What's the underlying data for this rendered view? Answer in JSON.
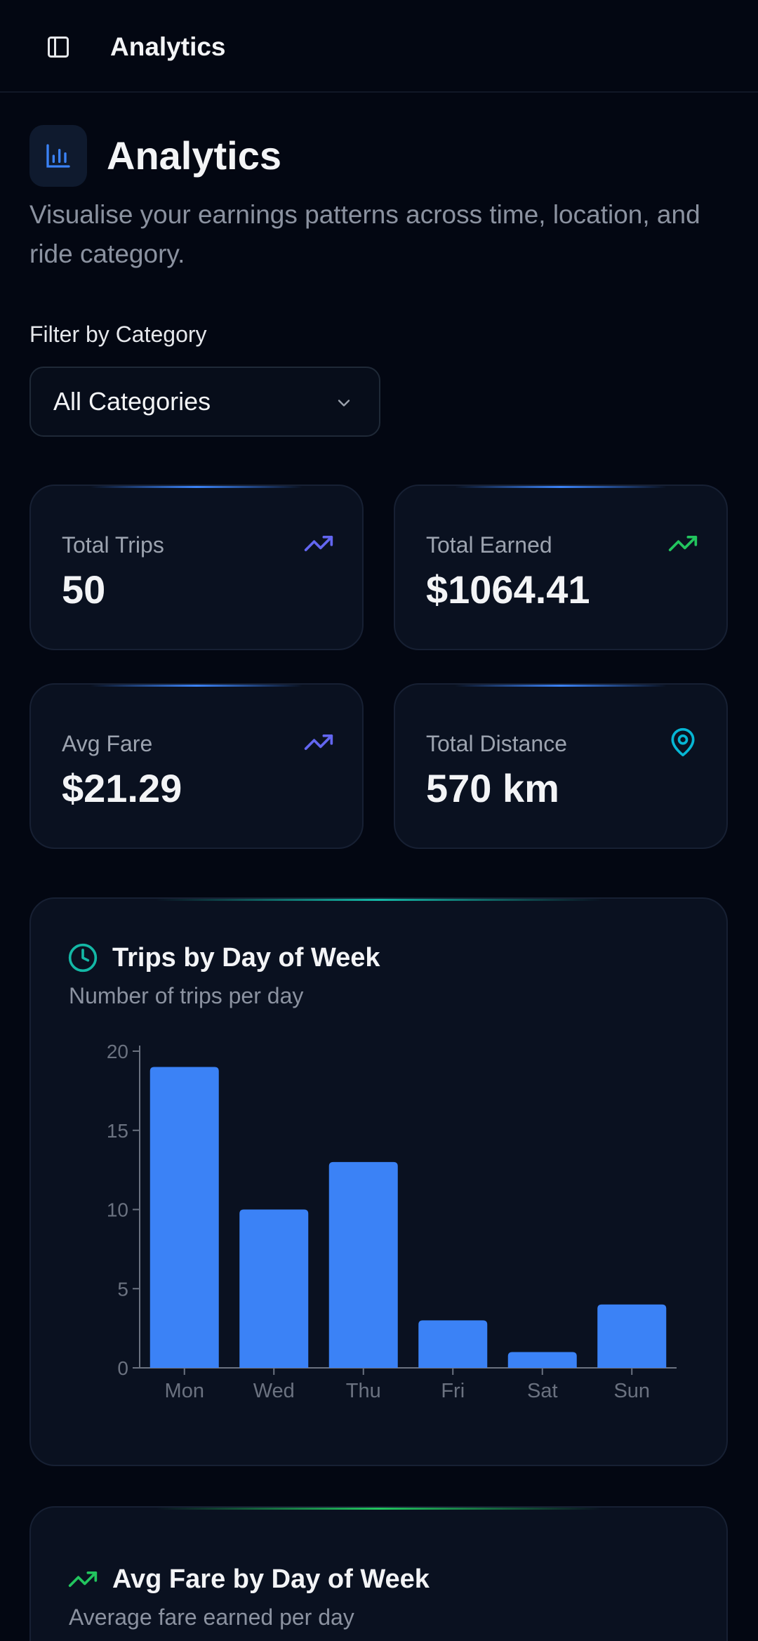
{
  "topbar": {
    "title": "Analytics",
    "toggle_icon": "sidebar-toggle-icon"
  },
  "header": {
    "title": "Analytics",
    "subtitle": "Visualise your earnings patterns across time, location, and ride category.",
    "icon": "bar-chart-icon"
  },
  "filter": {
    "label": "Filter by Category",
    "value": "All Categories"
  },
  "stats": [
    {
      "label": "Total Trips",
      "value": "50",
      "icon": "trending-up-icon",
      "color": "#6366f1"
    },
    {
      "label": "Total Earned",
      "value": "$1064.41",
      "icon": "trending-up-icon",
      "color": "#22c55e"
    },
    {
      "label": "Avg Fare",
      "value": "$21.29",
      "icon": "trending-up-icon",
      "color": "#6366f1"
    },
    {
      "label": "Total Distance",
      "value": "570 km",
      "icon": "map-pin-icon",
      "color": "#06b6d4"
    }
  ],
  "trips_chart": {
    "title": "Trips by Day of Week",
    "subtitle": "Number of trips per day",
    "icon": "clock-icon",
    "accent": "#14b8a6"
  },
  "fare_chart": {
    "title": "Avg Fare by Day of Week",
    "subtitle": "Average fare earned per day",
    "icon": "trending-up-icon",
    "accent": "#22c55e"
  },
  "chart_data": {
    "type": "bar",
    "categories": [
      "Mon",
      "Wed",
      "Thu",
      "Fri",
      "Sat",
      "Sun"
    ],
    "values": [
      19,
      10,
      13,
      3,
      1,
      4
    ],
    "yticks": [
      0,
      5,
      10,
      15,
      20
    ],
    "ylim": [
      0,
      20
    ],
    "bar_color": "#3b82f6",
    "grid": false
  }
}
